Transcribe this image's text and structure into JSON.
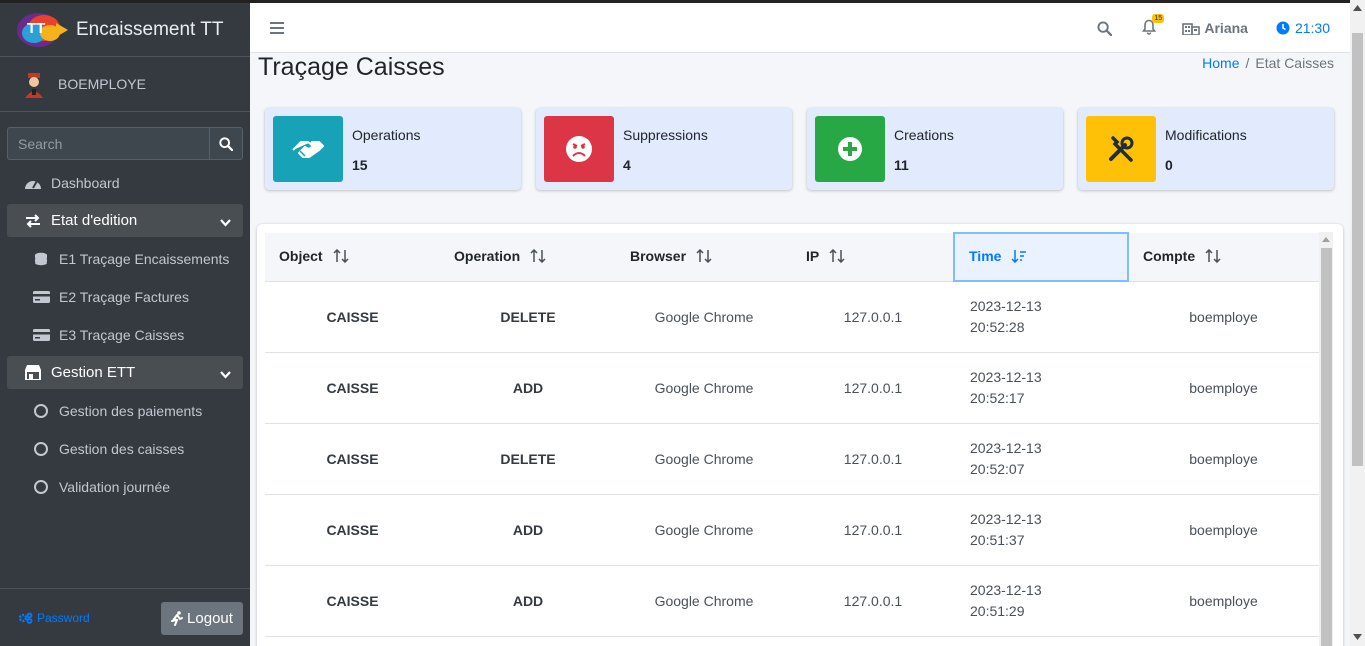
{
  "brand": {
    "name": "Encaissement TT"
  },
  "user": {
    "name": "BOEMPLOYE"
  },
  "search": {
    "placeholder": "Search"
  },
  "sidebar": {
    "items": [
      {
        "label": "Dashboard",
        "icon": "tachometer-icon"
      },
      {
        "label": "Etat d'edition",
        "icon": "exchange-icon",
        "open": true
      },
      {
        "label": "E1 Traçage Encaissements",
        "icon": "coins-icon"
      },
      {
        "label": "E2 Traçage Factures",
        "icon": "credit-card-icon"
      },
      {
        "label": "E3 Traçage Caisses",
        "icon": "credit-card-icon"
      },
      {
        "label": "Gestion ETT",
        "icon": "store-icon",
        "open": true
      },
      {
        "label": "Gestion des paiements",
        "icon": "circle-icon"
      },
      {
        "label": "Gestion des caisses",
        "icon": "circle-icon"
      },
      {
        "label": "Validation journée",
        "icon": "circle-icon"
      }
    ],
    "password_label": "Password",
    "logout_label": "Logout"
  },
  "topbar": {
    "notifications_count": "15",
    "location": "Ariana",
    "time": "21:30"
  },
  "page": {
    "title": "Traçage Caisses",
    "breadcrumb": {
      "home": "Home",
      "separator": "/",
      "current": "Etat Caisses"
    }
  },
  "stats": [
    {
      "label": "Operations",
      "value": "15",
      "color": "#17a2b8",
      "icon": "handshake-icon"
    },
    {
      "label": "Suppressions",
      "value": "4",
      "color": "#dc3545",
      "icon": "angry-face-icon"
    },
    {
      "label": "Creations",
      "value": "11",
      "color": "#28a745",
      "icon": "plus-circle-icon"
    },
    {
      "label": "Modifications",
      "value": "0",
      "color": "#ffc107",
      "icon": "tools-icon"
    }
  ],
  "table": {
    "columns": [
      "Object",
      "Operation",
      "Browser",
      "IP",
      "Time",
      "Compte"
    ],
    "sorted_column": "Time",
    "rows": [
      {
        "object": "CAISSE",
        "operation": "DELETE",
        "browser": "Google Chrome",
        "ip": "127.0.0.1",
        "date": "2023-12-13",
        "time": "20:52:28",
        "compte": "boemploye"
      },
      {
        "object": "CAISSE",
        "operation": "ADD",
        "browser": "Google Chrome",
        "ip": "127.0.0.1",
        "date": "2023-12-13",
        "time": "20:52:17",
        "compte": "boemploye"
      },
      {
        "object": "CAISSE",
        "operation": "DELETE",
        "browser": "Google Chrome",
        "ip": "127.0.0.1",
        "date": "2023-12-13",
        "time": "20:52:07",
        "compte": "boemploye"
      },
      {
        "object": "CAISSE",
        "operation": "ADD",
        "browser": "Google Chrome",
        "ip": "127.0.0.1",
        "date": "2023-12-13",
        "time": "20:51:37",
        "compte": "boemploye"
      },
      {
        "object": "CAISSE",
        "operation": "ADD",
        "browser": "Google Chrome",
        "ip": "127.0.0.1",
        "date": "2023-12-13",
        "time": "20:51:29",
        "compte": "boemploye"
      }
    ]
  }
}
